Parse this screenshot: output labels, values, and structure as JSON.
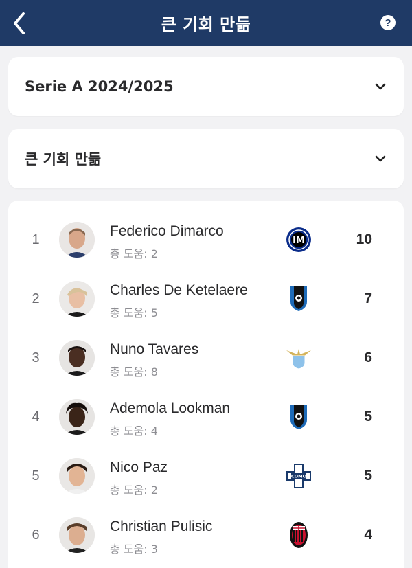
{
  "header": {
    "title": "큰 기회 만듦",
    "back_icon": "chevron-left-icon",
    "help_icon": "help-circle-icon",
    "help_glyph": "?",
    "bg_color": "#1f3a66"
  },
  "filters": {
    "season": "Serie A 2024/2025",
    "stat": "큰 기회 만듦"
  },
  "players": [
    {
      "rank": "1",
      "name": "Federico Dimarco",
      "sub": "총 도움: 2",
      "team_icon": "inter-crest-icon",
      "value": "10"
    },
    {
      "rank": "2",
      "name": "Charles De Ketelaere",
      "sub": "총 도움: 5",
      "team_icon": "atalanta-crest-icon",
      "value": "7"
    },
    {
      "rank": "3",
      "name": "Nuno Tavares",
      "sub": "총 도움: 8",
      "team_icon": "lazio-crest-icon",
      "value": "6"
    },
    {
      "rank": "4",
      "name": "Ademola Lookman",
      "sub": "총 도움: 4",
      "team_icon": "atalanta-crest-icon",
      "value": "5"
    },
    {
      "rank": "5",
      "name": "Nico Paz",
      "sub": "총 도움: 2",
      "team_icon": "como-crest-icon",
      "value": "5"
    },
    {
      "rank": "6",
      "name": "Christian Pulisic",
      "sub": "총 도움: 3",
      "team_icon": "milan-crest-icon",
      "value": "4"
    }
  ]
}
